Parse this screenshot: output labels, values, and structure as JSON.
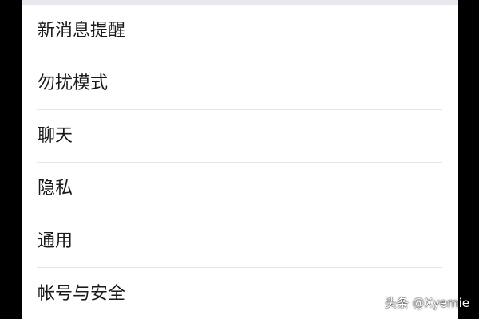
{
  "settings": {
    "items": [
      {
        "label": "新消息提醒"
      },
      {
        "label": "勿扰模式"
      },
      {
        "label": "聊天"
      },
      {
        "label": "隐私"
      },
      {
        "label": "通用"
      },
      {
        "label": "帐号与安全"
      }
    ]
  },
  "watermark": {
    "text": "头条 @Xyemie"
  },
  "colors": {
    "background": "#000000",
    "panel": "#ffffff",
    "top_strip": "#ebe7ef",
    "divider": "#e6e6e6",
    "text": "#1a1a1a"
  }
}
